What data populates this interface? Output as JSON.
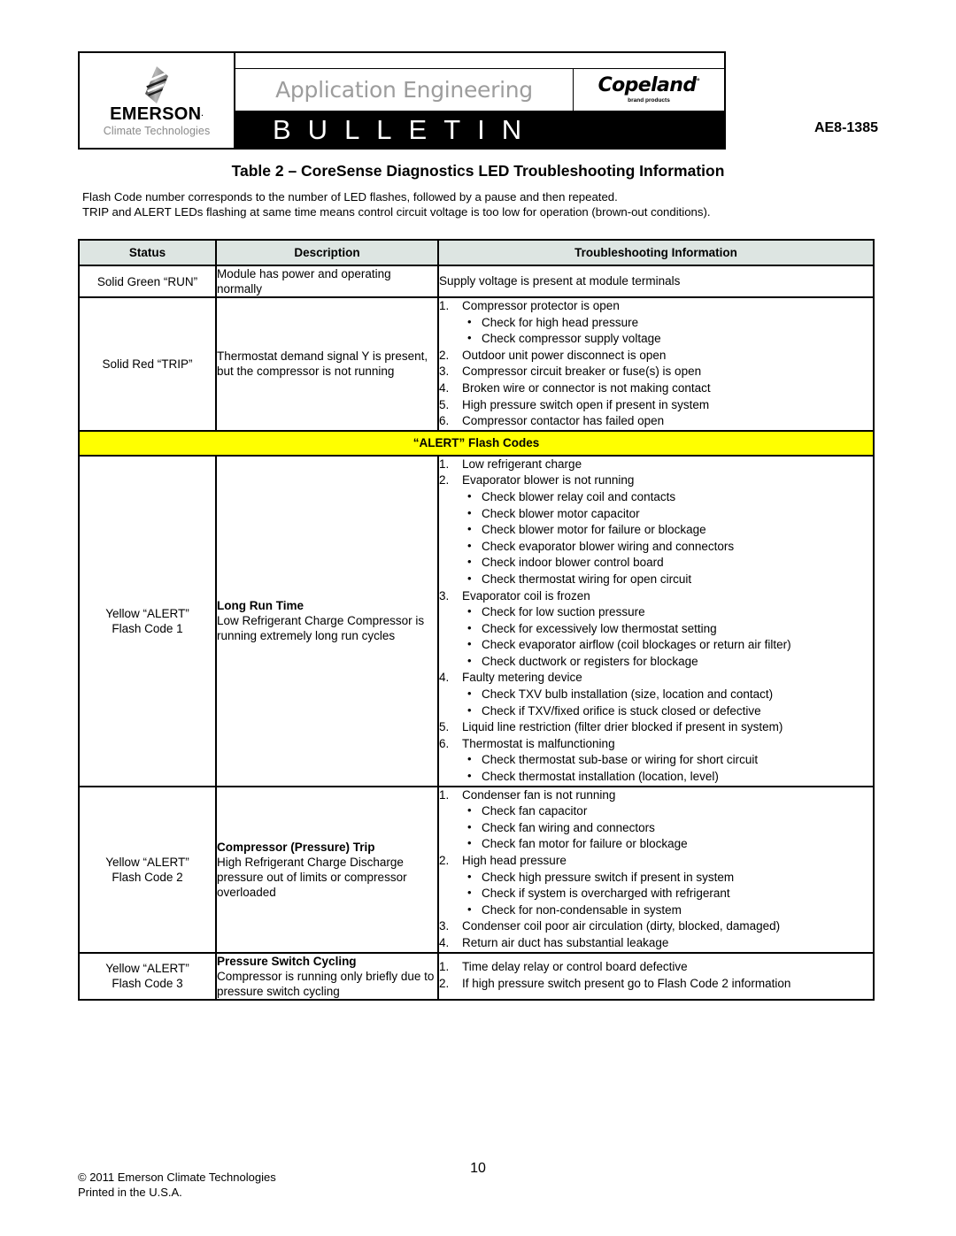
{
  "header": {
    "emerson_word": "EMERSON",
    "emerson_tm": ".",
    "emerson_sub": "Climate Technologies",
    "app_engineering": "Application Engineering",
    "copeland_word": "Copeland",
    "copeland_reg": "°",
    "copeland_sub": "brand products",
    "bulletin": "BULLETIN",
    "doc_number": "AE8-1385"
  },
  "title": "Table 2 – CoreSense Diagnostics LED Troubleshooting Information",
  "intro": {
    "line1": "Flash Code number corresponds to the number of LED flashes, followed by a pause and then repeated.",
    "line2": "TRIP and ALERT LEDs flashing at same time means control circuit voltage is too low for operation (brown-out conditions)."
  },
  "table": {
    "columns": [
      "Status",
      "Description",
      "Troubleshooting Information"
    ],
    "alert_banner": "“ALERT” Flash Codes",
    "rows": [
      {
        "status": "Solid Green “RUN”",
        "description": "Module has power and operating normally",
        "description_heading": "",
        "trouble_plain": "Supply voltage is present at module terminals",
        "items": []
      },
      {
        "status": "Solid Red “TRIP”",
        "description": "Thermostat demand signal Y is present, but the compressor is not running",
        "description_heading": "",
        "trouble_plain": "",
        "items": [
          {
            "n": "1.",
            "text": "Compressor protector is open",
            "subs": [
              "Check for high head pressure",
              "Check compressor supply voltage"
            ]
          },
          {
            "n": "2.",
            "text": "Outdoor unit power disconnect is open",
            "subs": []
          },
          {
            "n": "3.",
            "text": "Compressor circuit breaker or fuse(s) is open",
            "subs": []
          },
          {
            "n": "4.",
            "text": "Broken wire or connector is not making contact",
            "subs": []
          },
          {
            "n": "5.",
            "text": "High pressure switch open if present in system",
            "subs": []
          },
          {
            "n": "6.",
            "text": "Compressor contactor has failed open",
            "subs": []
          }
        ]
      },
      {
        "status": "Yellow “ALERT” Flash Code 1",
        "status_line1": "Yellow “ALERT”",
        "status_line2": "Flash Code 1",
        "description_heading": "Long Run Time",
        "description": "Low Refrigerant Charge Compressor is running extremely long run cycles",
        "trouble_plain": "",
        "items": [
          {
            "n": "1.",
            "text": "Low refrigerant charge",
            "subs": []
          },
          {
            "n": "2.",
            "text": "Evaporator blower is not running",
            "subs": [
              "Check blower relay coil and contacts",
              "Check blower motor capacitor",
              "Check blower motor for failure or blockage",
              "Check evaporator blower wiring and connectors",
              "Check indoor blower control board",
              "Check thermostat wiring for open circuit"
            ]
          },
          {
            "n": "3.",
            "text": "Evaporator coil is frozen",
            "subs": [
              "Check for low suction pressure",
              "Check for excessively low thermostat setting",
              "Check evaporator airflow (coil blockages or return air filter)",
              "Check ductwork or registers for blockage"
            ]
          },
          {
            "n": "4.",
            "text": "Faulty metering device",
            "subs": [
              "Check TXV bulb installation (size, location and contact)",
              "Check if TXV/fixed orifice is stuck closed or defective"
            ]
          },
          {
            "n": "5.",
            "text": "Liquid line restriction (filter drier blocked if present in system)",
            "subs": []
          },
          {
            "n": "6.",
            "text": "Thermostat is malfunctioning",
            "subs": [
              "Check thermostat sub-base or wiring for short circuit",
              "Check thermostat installation (location, level)"
            ]
          }
        ]
      },
      {
        "status": "Yellow “ALERT” Flash Code 2",
        "status_line1": "Yellow “ALERT”",
        "status_line2": "Flash Code 2",
        "description_heading": "Compressor (Pressure) Trip",
        "description": "High Refrigerant Charge Discharge pressure out of limits or compressor overloaded",
        "trouble_plain": "",
        "items": [
          {
            "n": "1.",
            "text": "Condenser fan is not running",
            "subs": [
              "Check fan capacitor",
              "Check fan wiring and connectors",
              "Check fan motor for failure or blockage"
            ]
          },
          {
            "n": "2.",
            "text": "High head pressure",
            "subs": [
              "Check high pressure switch if present in system",
              "Check if system is overcharged with refrigerant",
              "Check for non-condensable in system"
            ]
          },
          {
            "n": "3.",
            "text": "Condenser coil poor air circulation (dirty, blocked, damaged)",
            "subs": []
          },
          {
            "n": "4.",
            "text": "Return air duct has substantial leakage",
            "subs": []
          }
        ]
      },
      {
        "status": "Yellow “ALERT” Flash Code 3",
        "status_line1": "Yellow “ALERT”",
        "status_line2": "Flash Code 3",
        "description_heading": "Pressure Switch Cycling",
        "description": "Compressor is running only briefly due to pressure switch cycling",
        "trouble_plain": "",
        "items": [
          {
            "n": "1.",
            "text": "Time delay relay or control board defective",
            "subs": []
          },
          {
            "n": "2.",
            "text": "If high pressure switch present go to Flash Code 2 information",
            "subs": []
          }
        ]
      }
    ]
  },
  "footer": {
    "copyright": "© 2011 Emerson Climate Technologies",
    "printed": "Printed in the U.S.A.",
    "page_number": "10"
  },
  "colors": {
    "header_bg": "#dde5e2",
    "alert_yellow": "#ffff00",
    "bulletin_bar": "#000000",
    "app_eng_gray": "#9d9d9d"
  }
}
